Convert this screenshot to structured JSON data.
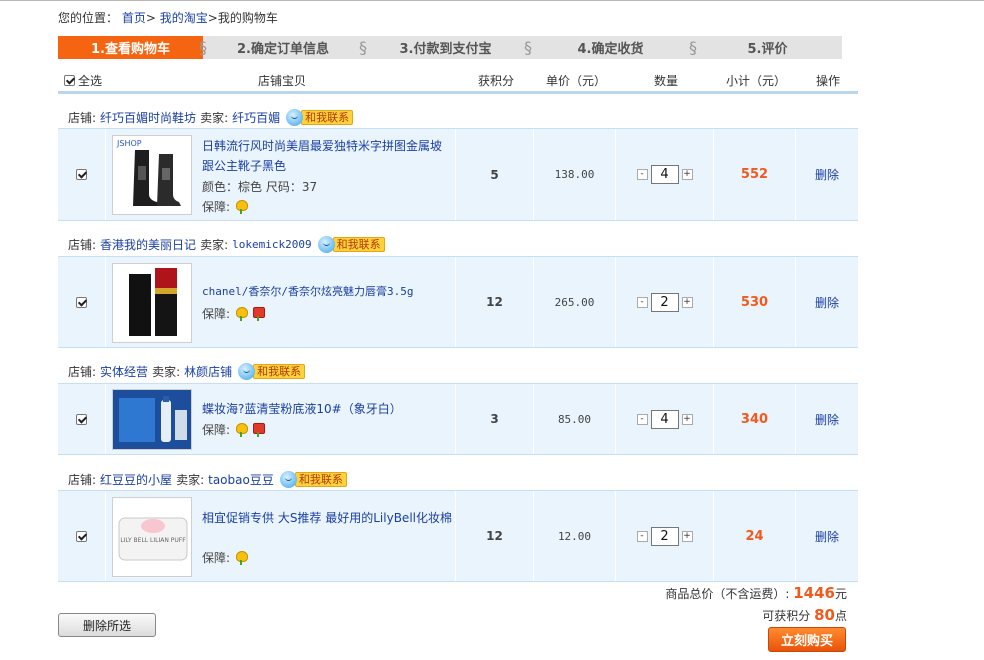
{
  "breadcrumb": {
    "prefix": "您的位置：",
    "home": "首页",
    "sep": ">",
    "mytaobao": "我的淘宝",
    "current": "我的购物车"
  },
  "steps": [
    {
      "label": "1.查看购物车",
      "active": true
    },
    {
      "label": "2.确定订单信息",
      "active": false
    },
    {
      "label": "3.付款到支付宝",
      "active": false
    },
    {
      "label": "4.确定收货",
      "active": false
    },
    {
      "label": "5.评价",
      "active": false
    }
  ],
  "table_header": {
    "select_all": "全选",
    "product": "店铺宝贝",
    "points": "获积分",
    "price": "单价（元）",
    "qty": "数量",
    "subtotal": "小计（元）",
    "op": "操作"
  },
  "labels": {
    "shop": "店铺:",
    "seller": "卖家:",
    "contact": "和我联系",
    "guarantee": "保障:",
    "delete": "删除",
    "minus": "-",
    "plus": "+"
  },
  "items": [
    {
      "shop": "纤巧百媚时尚鞋坊",
      "seller": "纤巧百媚",
      "name": "日韩流行风时尚美眉最爱独特米字拼图金属坡跟公主靴子黑色",
      "attrs": "颜色：棕色 尺码：37",
      "points": "5",
      "price": "138.00",
      "qty": "4",
      "subtotal": "552",
      "thumb_text": "JSHOP",
      "thumb_kind": "boots",
      "guarantee_icons": [
        "guarantee-flower-icon"
      ]
    },
    {
      "shop": "香港我的美丽日记",
      "seller": "lokemick2009",
      "name": "chanel/香奈尔/香奈尔炫亮魅力唇膏3.5g",
      "attrs": "",
      "points": "12",
      "price": "265.00",
      "qty": "2",
      "subtotal": "530",
      "thumb_text": "",
      "thumb_kind": "lipstick",
      "guarantee_icons": [
        "guarantee-flower-icon",
        "genuine-goods-icon"
      ]
    },
    {
      "shop": "实体经营",
      "seller": "林颜店铺",
      "name": "蝶妆海?蓝清莹粉底液10#（象牙白）",
      "attrs": "",
      "points": "3",
      "price": "85.00",
      "qty": "4",
      "subtotal": "340",
      "thumb_text": "",
      "thumb_kind": "foundation",
      "guarantee_icons": [
        "guarantee-flower-icon",
        "genuine-goods-icon"
      ]
    },
    {
      "shop": "红豆豆的小屋",
      "seller": "taobao豆豆",
      "name": "相宜促销专供 大S推荐 最好用的LilyBell化妆棉",
      "attrs": "",
      "points": "12",
      "price": "12.00",
      "qty": "2",
      "subtotal": "24",
      "thumb_text": "LILY BELL LILIAN PUFF",
      "thumb_kind": "cotton",
      "guarantee_icons": [
        "guarantee-flower-icon"
      ]
    }
  ],
  "summary": {
    "total_label": "商品总价（不含运费）:",
    "total_value": "1446",
    "total_unit": "元",
    "points_label": "可获积分",
    "points_value": "80",
    "points_unit": "点"
  },
  "buttons": {
    "delete_selected": "删除所选",
    "buy_now": "立刻购买"
  },
  "colors": {
    "accent": "#f56410",
    "link": "#1a3fa3",
    "row_bg": "#eaf4fc",
    "price_highlight": "#f2591c"
  }
}
